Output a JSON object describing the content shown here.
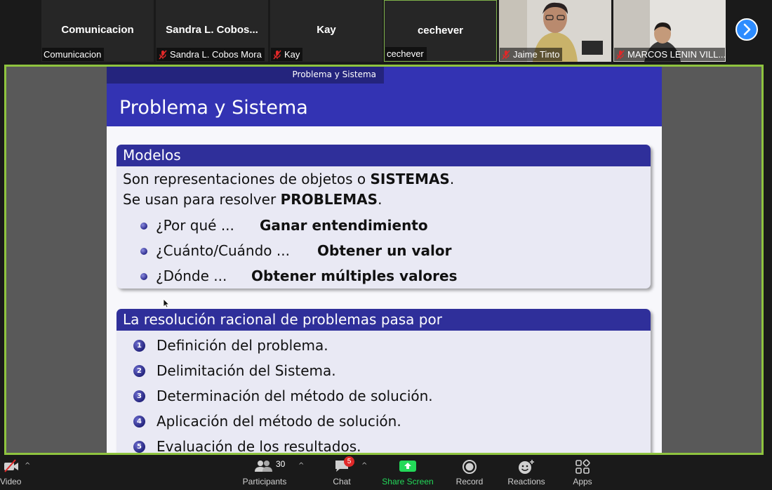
{
  "participants": [
    {
      "tile_name": "Comunicacion",
      "label": "Comunicacion",
      "muted": false,
      "video": false
    },
    {
      "tile_name": "Sandra  L. Cobos...",
      "label": "Sandra L. Cobos Mora",
      "muted": true,
      "video": false
    },
    {
      "tile_name": "Kay",
      "label": "Kay",
      "muted": true,
      "video": false
    },
    {
      "tile_name": "cechever",
      "label": "cechever",
      "muted": false,
      "video": false
    },
    {
      "tile_name": "",
      "label": "Jaime Tinto",
      "muted": true,
      "video": true
    },
    {
      "tile_name": "",
      "label": "MARCOS LENIN VILL...",
      "muted": true,
      "video": true
    }
  ],
  "slide": {
    "nav_section": "Problema y Sistema",
    "title": "Problema y Sistema",
    "block1": {
      "title": "Modelos",
      "line1_text": "Son representaciones de objetos o ",
      "line1_bold": "SISTEMAS",
      "line1_end": ".",
      "line2_text": "Se usan para resolver ",
      "line2_bold": "PROBLEMAS",
      "line2_end": ".",
      "items": [
        {
          "question": "¿Por qué ...",
          "answer": "Ganar entendimiento"
        },
        {
          "question": "¿Cuánto/Cuándo ...",
          "answer": "Obtener un valor"
        },
        {
          "question": "¿Dónde ...",
          "answer": "Obtener múltiples valores"
        }
      ]
    },
    "block2": {
      "title": "La resolución racional de problemas pasa por",
      "steps": [
        {
          "num": "1",
          "text": "Definición del problema."
        },
        {
          "num": "2",
          "text": "Delimitación del Sistema."
        },
        {
          "num": "3",
          "text": "Determinación del método de solución."
        },
        {
          "num": "4",
          "text": "Aplicación del método de solución."
        },
        {
          "num": "5",
          "text": "Evaluación de los resultados."
        }
      ]
    }
  },
  "toolbar": {
    "video_label": "Video",
    "participants_label": "Participants",
    "participants_count": "30",
    "chat_label": "Chat",
    "chat_badge": "5",
    "share_label": "Share Screen",
    "record_label": "Record",
    "reactions_label": "Reactions",
    "apps_label": "Apps"
  },
  "colors": {
    "slide_header": "#3333b3",
    "block_title_bg": "#2f2f9a",
    "share_border": "#8fc43f",
    "share_screen_green": "#23d959",
    "mute_red": "#e02828"
  },
  "icons": [
    "mic-off-icon",
    "next-page-icon",
    "video-icon",
    "participants-icon",
    "chat-icon",
    "share-screen-icon",
    "record-icon",
    "reactions-icon",
    "apps-icon"
  ]
}
